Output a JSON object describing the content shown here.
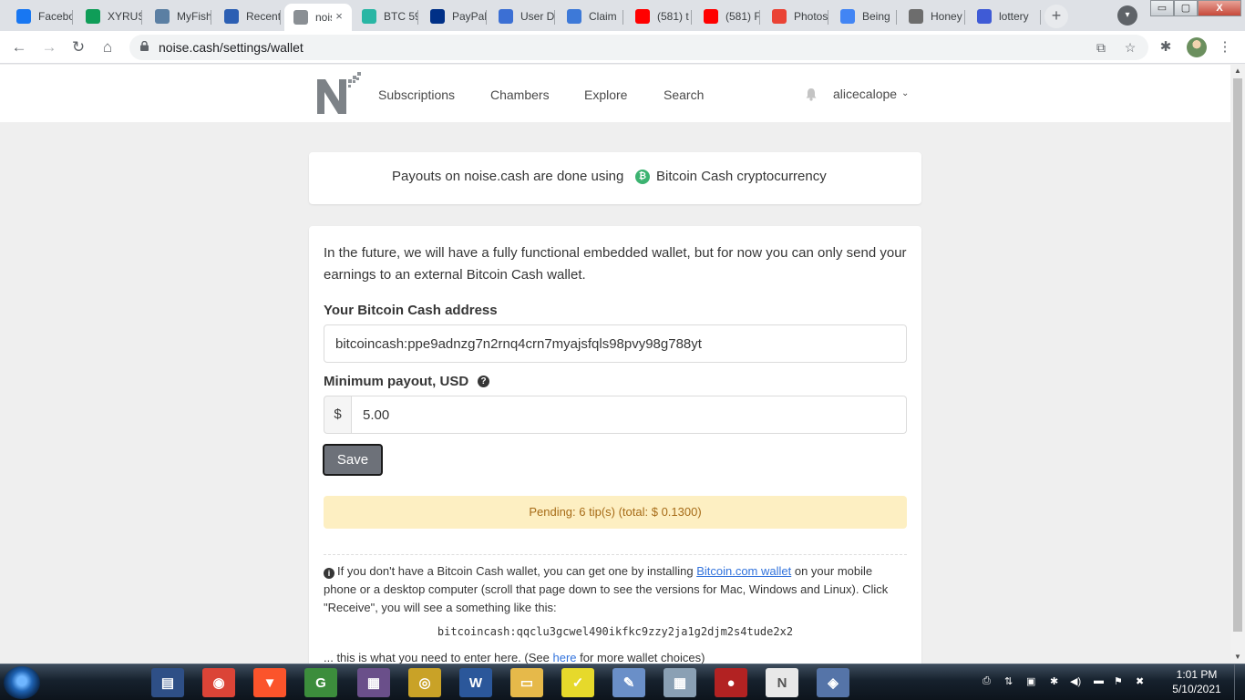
{
  "browser": {
    "tabs": [
      {
        "title": "Facebook",
        "icon": "facebook-icon",
        "color": "#1877f2"
      },
      {
        "title": "XYRUS",
        "icon": "sheets-icon",
        "color": "#0f9d58"
      },
      {
        "title": "MyFish",
        "icon": "fish-icon",
        "color": "#5b7fa3"
      },
      {
        "title": "Recent",
        "icon": "c-icon",
        "color": "#2c5fb3"
      },
      {
        "title": "noise.cash",
        "icon": "noise-icon",
        "color": "#8a8f94"
      },
      {
        "title": "BTC 59",
        "icon": "btc-icon",
        "color": "#29b6a4"
      },
      {
        "title": "PayPal",
        "icon": "paypal-icon",
        "color": "#003087"
      },
      {
        "title": "User D",
        "icon": "fp-icon",
        "color": "#3b6fd4"
      },
      {
        "title": "Claim",
        "icon": "drop-icon",
        "color": "#3d79d8"
      },
      {
        "title": "(581) t",
        "icon": "youtube-icon",
        "color": "#ff0000"
      },
      {
        "title": "(581) F",
        "icon": "youtube-icon",
        "color": "#ff0000"
      },
      {
        "title": "Photos",
        "icon": "photos-icon",
        "color": "#ea4335"
      },
      {
        "title": "Being",
        "icon": "google-icon",
        "color": "#4285f4"
      },
      {
        "title": "Honey",
        "icon": "bike-icon",
        "color": "#6d6d6d"
      },
      {
        "title": "lottery",
        "icon": "lottery-icon",
        "color": "#3f5bd6"
      }
    ],
    "close_tab": "×",
    "new_tab": "+",
    "window_controls": [
      "▭",
      "▢",
      "X"
    ],
    "url": "noise.cash/settings/wallet"
  },
  "site_nav": {
    "links": [
      "Subscriptions",
      "Chambers",
      "Explore",
      "Search"
    ],
    "user": "alicecalope",
    "caret": "⌄"
  },
  "notice": {
    "text_before": "Payouts on noise.cash are done using",
    "badge": "₿",
    "text_after": "Bitcoin Cash cryptocurrency"
  },
  "wallet": {
    "intro": "In the future, we will have a fully functional embedded wallet, but for now you can only send your earnings to an external Bitcoin Cash wallet.",
    "address_label": "Your Bitcoin Cash address",
    "address_value": "bitcoincash:ppe9adnzg7n2rnq4crn7myajsfqls98pvy98g788yt",
    "payout_label": "Minimum payout, USD",
    "help": "?",
    "currency_symbol": "$",
    "payout_value": "5.00",
    "save_label": "Save",
    "pending": "Pending: 6 tip(s) (total: $ 0.1300)",
    "info_icon": "i",
    "info_before": "If you don't have a Bitcoin Cash wallet, you can get one by installing",
    "info_link": "Bitcoin.com wallet",
    "info_after": "on your mobile phone or a desktop computer (scroll that page down to see the versions for Mac, Windows and Linux). Click \"Receive\", you will see a something like this:",
    "example_address": "bitcoincash:qqclu3gcwel490ikfkc9zzy2ja1g2djm2s4tude2x2",
    "more_before": "... this is what you need to enter here. (See",
    "more_link": "here",
    "more_after": "for more wallet choices)"
  },
  "taskbar": {
    "apps": [
      {
        "name": "notepad-app",
        "glyph": "▤",
        "color": "#2e4f86"
      },
      {
        "name": "chrome-app",
        "glyph": "◉",
        "color": "#db4437"
      },
      {
        "name": "brave-app",
        "glyph": "▼",
        "color": "#fb542b"
      },
      {
        "name": "g-app",
        "glyph": "G",
        "color": "#3c8d3c"
      },
      {
        "name": "network-app",
        "glyph": "▦",
        "color": "#6a4f8a"
      },
      {
        "name": "seal-app",
        "glyph": "◎",
        "color": "#c9a227"
      },
      {
        "name": "word-app",
        "glyph": "W",
        "color": "#2b579a"
      },
      {
        "name": "explorer-app",
        "glyph": "▭",
        "color": "#e6b94a"
      },
      {
        "name": "sticky-notes-app",
        "glyph": "✓",
        "color": "#e6d92b"
      },
      {
        "name": "paint-app",
        "glyph": "✎",
        "color": "#6a8fc8"
      },
      {
        "name": "calculator-app",
        "glyph": "▦",
        "color": "#8aa0b4"
      },
      {
        "name": "recorder-app",
        "glyph": "●",
        "color": "#b22222"
      },
      {
        "name": "noise-app",
        "glyph": "N",
        "color": "#e8e8e8"
      },
      {
        "name": "remote-app",
        "glyph": "◈",
        "color": "#5574a8"
      }
    ],
    "time": "1:01 PM",
    "date": "5/10/2021"
  }
}
